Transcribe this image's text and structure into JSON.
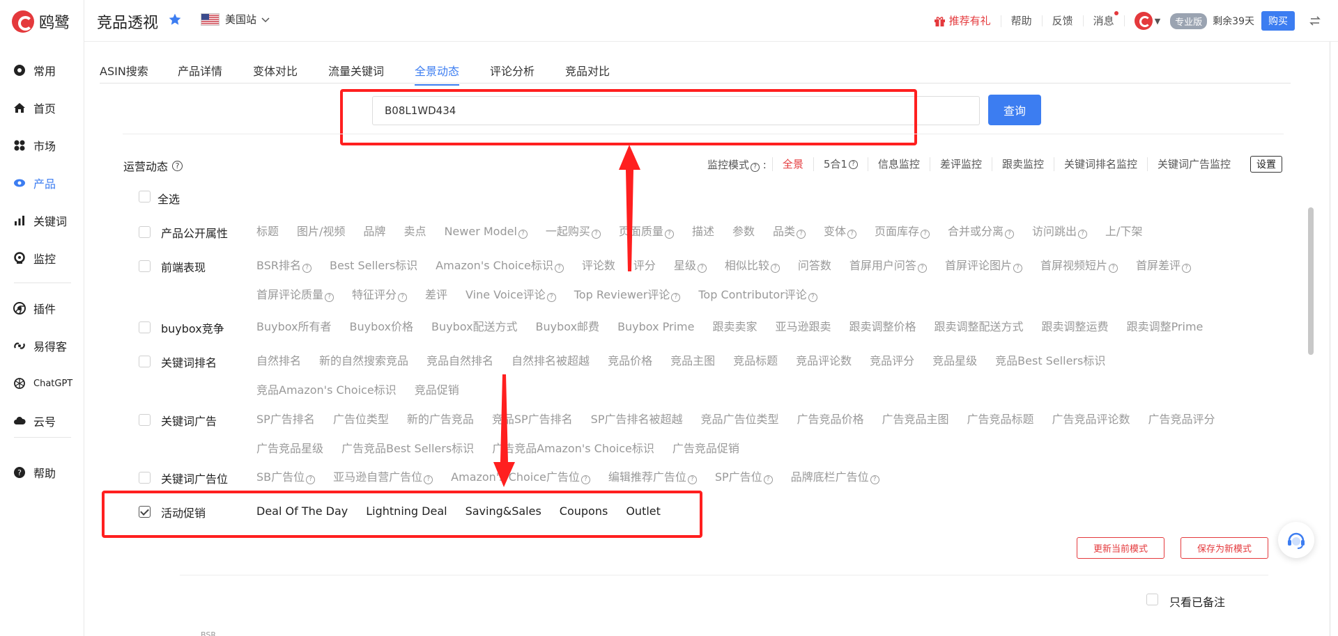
{
  "brand": {
    "name": "鸥鹭"
  },
  "sidebar": {
    "items": [
      {
        "label": "常用",
        "icon": "gear-icon"
      },
      {
        "label": "首页",
        "icon": "home-icon"
      },
      {
        "label": "市场",
        "icon": "market-icon"
      },
      {
        "label": "产品",
        "icon": "eye-icon",
        "active": true
      },
      {
        "label": "关键词",
        "icon": "bar-chart-icon"
      },
      {
        "label": "监控",
        "icon": "monitor-icon"
      },
      {
        "label": "插件",
        "icon": "chrome-icon"
      },
      {
        "label": "易得客",
        "icon": "link-icon"
      },
      {
        "label": "ChatGPT",
        "icon": "openai-icon"
      },
      {
        "label": "云号",
        "icon": "cloud-icon"
      },
      {
        "label": "帮助",
        "icon": "help-icon"
      }
    ]
  },
  "header": {
    "title": "竞品透视",
    "site": "美国站",
    "recommend": "推荐有礼",
    "help": "帮助",
    "feedback": "反馈",
    "messages": "消息",
    "plan_badge": "专业版",
    "remaining": "剩余39天",
    "buy": "购买"
  },
  "tabs": [
    {
      "label": "ASIN搜索"
    },
    {
      "label": "产品详情"
    },
    {
      "label": "变体对比"
    },
    {
      "label": "流量关键词"
    },
    {
      "label": "全景动态",
      "active": true
    },
    {
      "label": "评论分析"
    },
    {
      "label": "竞品对比"
    }
  ],
  "search": {
    "value": "B08L1WD434",
    "button": "查询"
  },
  "ops": {
    "title": "运营动态",
    "mode_label": "监控模式",
    "modes": [
      "全景",
      "5合1",
      "信息监控",
      "差评监控",
      "跟卖监控",
      "关键词排名监控",
      "关键词广告监控"
    ],
    "settings": "设置",
    "select_all": "全选"
  },
  "rows": [
    {
      "label": "产品公开属性",
      "checked": false,
      "items": [
        "标题",
        "图片/视频",
        "品牌",
        "卖点",
        "Newer Model",
        "一起购买",
        "页面质量",
        "描述",
        "参数",
        "品类",
        "变体",
        "页面库存",
        "合并或分离",
        "访问跳出",
        "上/下架"
      ]
    },
    {
      "label": "前端表现",
      "checked": false,
      "items": [
        "BSR排名",
        "Best Sellers标识",
        "Amazon's Choice标识",
        "评论数",
        "评分",
        "星级",
        "相似比较",
        "问答数",
        "首屏用户问答",
        "首屏评论图片",
        "首屏视频短片",
        "首屏差评",
        "首屏评论质量",
        "特征评分",
        "差评",
        "Vine Voice评论",
        "Top Reviewer评论",
        "Top Contributor评论"
      ]
    },
    {
      "label": "buybox竞争",
      "checked": false,
      "items": [
        "Buybox所有者",
        "Buybox价格",
        "Buybox配送方式",
        "Buybox邮费",
        "Buybox Prime",
        "跟卖卖家",
        "亚马逊跟卖",
        "跟卖调整价格",
        "跟卖调整配送方式",
        "跟卖调整运费",
        "跟卖调整Prime"
      ]
    },
    {
      "label": "关键词排名",
      "checked": false,
      "items": [
        "自然排名",
        "新的自然搜索竞品",
        "竞品自然排名",
        "自然排名被超越",
        "竞品价格",
        "竞品主图",
        "竞品标题",
        "竞品评论数",
        "竞品评分",
        "竞品星级",
        "竞品Best Sellers标识",
        "竞品Amazon's Choice标识",
        "竞品促销"
      ]
    },
    {
      "label": "关键词广告",
      "checked": false,
      "items": [
        "SP广告排名",
        "广告位类型",
        "新的广告竞品",
        "竞品SP广告排名",
        "SP广告排名被超越",
        "竞品广告位类型",
        "广告竞品价格",
        "广告竞品主图",
        "广告竞品标题",
        "广告竞品评论数",
        "广告竞品评分",
        "广告竞品星级",
        "广告竞品Best Sellers标识",
        "广告竞品Amazon's Choice标识",
        "广告竞品促销"
      ]
    },
    {
      "label": "关键词广告位",
      "checked": false,
      "items": [
        "SB广告位",
        "亚马逊自营广告位",
        "Amazon's Choice广告位",
        "编辑推荐广告位",
        "SP广告位",
        "品牌底栏广告位"
      ]
    },
    {
      "label": "活动促销",
      "checked": true,
      "items": [
        "Deal Of The Day",
        "Lightning Deal",
        "Saving&Sales",
        "Coupons",
        "Outlet"
      ]
    }
  ],
  "help_marks": {
    "row0": [
      4,
      5,
      6,
      9,
      10,
      11,
      12,
      13
    ],
    "row1": [
      0,
      2,
      5,
      6,
      8,
      9,
      10,
      11,
      12,
      13,
      15,
      16,
      17
    ],
    "row5": [
      0,
      1,
      2,
      3,
      4,
      5
    ]
  },
  "actions": {
    "update_mode": "更新当前模式",
    "save_mode": "保存为新模式"
  },
  "filter": {
    "only_noted": "只看已备注"
  },
  "footer_cut": "BSR",
  "colors": {
    "accent": "#3c7df1",
    "brand_red": "#e4393c",
    "highlight": "#ff1f1f"
  }
}
